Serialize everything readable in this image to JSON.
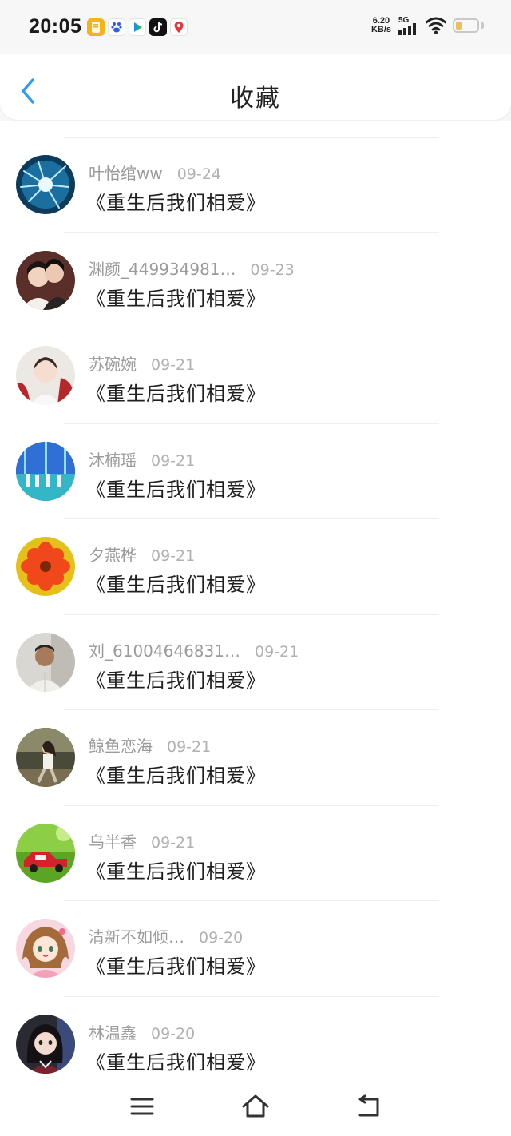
{
  "status_bar": {
    "time": "20:05",
    "net_speed_value": "6.20",
    "net_speed_unit": "KB/s",
    "network_type": "5G",
    "app_icons": [
      "notes-app-icon",
      "baidu-app-icon",
      "video-app-icon",
      "tiktok-app-icon",
      "map-app-icon"
    ],
    "battery_fraction": 0.32
  },
  "header": {
    "title": "收藏",
    "back_icon": "chevron-left-icon",
    "accent_color": "#2f9cf2"
  },
  "favorites": [
    {
      "name": "叶怡绾ww",
      "date": "09-24",
      "title": "《重生后我们相爱》",
      "avatar": "blue-flower-avatar"
    },
    {
      "name": "渊颜_449934981…",
      "date": "09-23",
      "title": "《重生后我们相爱》",
      "avatar": "couple-avatar"
    },
    {
      "name": "苏碗婉",
      "date": "09-21",
      "title": "《重生后我们相爱》",
      "avatar": "portrait-avatar"
    },
    {
      "name": "沐楠瑶",
      "date": "09-21",
      "title": "《重生后我们相爱》",
      "avatar": "stage-avatar"
    },
    {
      "name": "夕燕桦",
      "date": "09-21",
      "title": "《重生后我们相爱》",
      "avatar": "orange-flower-avatar"
    },
    {
      "name": "刘_61004646831…",
      "date": "09-21",
      "title": "《重生后我们相爱》",
      "avatar": "man-avatar"
    },
    {
      "name": "鲸鱼恋海",
      "date": "09-21",
      "title": "《重生后我们相爱》",
      "avatar": "outdoor-avatar"
    },
    {
      "name": "乌半香",
      "date": "09-21",
      "title": "《重生后我们相爱》",
      "avatar": "toy-car-avatar"
    },
    {
      "name": "清新不如倾…",
      "date": "09-20",
      "title": "《重生后我们相爱》",
      "avatar": "anime-girl-avatar"
    },
    {
      "name": "林温鑫",
      "date": "09-20",
      "title": "《重生后我们相爱》",
      "avatar": "girl-avatar"
    }
  ],
  "nav_bar": {
    "menu_icon": "menu-icon",
    "home_icon": "home-icon",
    "back_icon": "back-icon"
  }
}
